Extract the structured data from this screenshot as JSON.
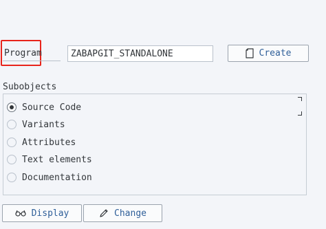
{
  "program": {
    "label": "Program",
    "value": "ZABAPGIT_STANDALONE",
    "create_label": "Create",
    "highlight_color": "#e8241b"
  },
  "subobjects": {
    "title": "Subobjects",
    "options": [
      {
        "label": "Source Code",
        "selected": true
      },
      {
        "label": "Variants",
        "selected": false
      },
      {
        "label": "Attributes",
        "selected": false
      },
      {
        "label": "Text elements",
        "selected": false
      },
      {
        "label": "Documentation",
        "selected": false
      }
    ]
  },
  "actions": {
    "display_label": "Display",
    "change_label": "Change"
  },
  "icons": {
    "create": "document-icon",
    "display": "glasses-icon",
    "change": "pencil-icon"
  }
}
